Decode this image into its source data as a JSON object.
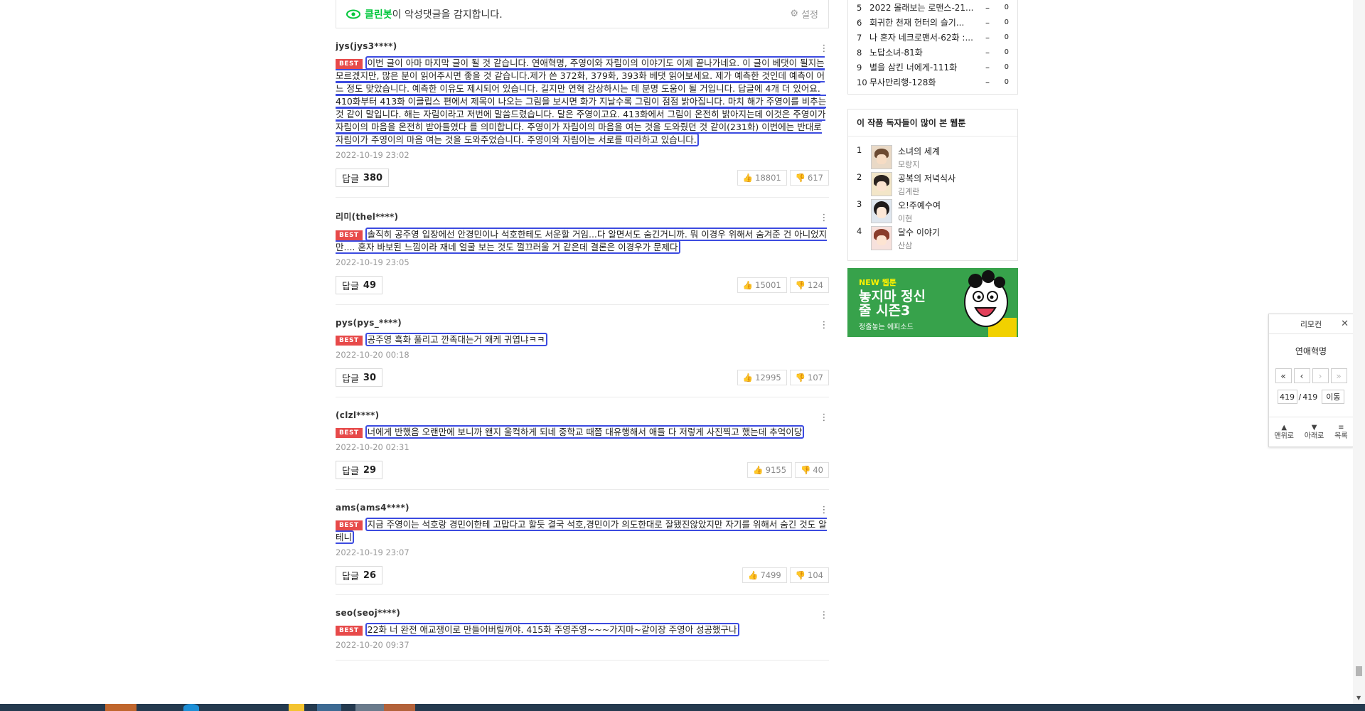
{
  "cleanbot": {
    "brand": "클린봇",
    "text": "이 악성댓글을 감지합니다.",
    "setting_label": "설정"
  },
  "comments": [
    {
      "user": "jys(jys3****)",
      "badge": "BEST",
      "text": "이번 글이 아마 마지막 글이 될 것 같습니다. 연애혁명, 주영이와 자림이의 이야기도 이제 끝나가네요. 이 글이 베댓이 될지는 모르겠지만, 많은 분이 읽어주시면 좋을 것 같습니다.제가 쓴 372화, 379화, 393화 베댓 읽어보세요. 제가 예측한 것인데 예측이 어느 정도 맞았습니다. 예측한 이유도 제시되어 있습니다. 길지만 연혁 감상하시는 데 분명 도움이 될 거입니다. 답글에 4개 더 있어요. 410화부터 413화 이클립스 편에서 제목이 나오는 그림을 보시면 화가 지날수록 그림이 점점 밝아집니다. 마치 해가 주영이를 비추는 것 같이 말입니다. 해는 자림이라고 저번에 말씀드렸습니다. 달은 주영이고요. 413화에서 그림이 온전히 밝아지는데 이것은 주영이가 자림이의 마음을 온전히 받아들였다 를 의미합니다. 주영이가 자림이의 마음을 여는 것을 도와줬던 것 같이(231화) 이번에는 반대로 자림이가 주영이의 마음 여는 것을 도와주었습니다. 주영이와 자림이는 서로를 따라하고 있습니다.",
      "date": "2022-10-19 23:02",
      "reply_label": "답글",
      "replies": "380",
      "up": "18801",
      "down": "617"
    },
    {
      "user": "리미(thel****)",
      "badge": "BEST",
      "text": "솔직히 공주영 입장에선 안경민이나 석호한테도 서운할 거임...다 알면서도 숨긴거니까. 뭐 이경우 위해서 숨겨준 건 아니었지만.... 혼자 바보된 느낌이라 재네 얼굴 보는 것도 껄끄러울 거 같은데 결론은 이경우가 문제다",
      "date": "2022-10-19 23:05",
      "reply_label": "답글",
      "replies": "49",
      "up": "15001",
      "down": "124"
    },
    {
      "user": "pys(pys_****)",
      "badge": "BEST",
      "text": "공주영 흑화 풀리고 깐족대는거 왜케 귀엽냐ㅋㅋ",
      "date": "2022-10-20 00:18",
      "reply_label": "답글",
      "replies": "30",
      "up": "12995",
      "down": "107"
    },
    {
      "user": "(clzl****)",
      "badge": "BEST",
      "text": "너에게 반했음 오랜만에 보니까 왠지 울컥하게 되네 중학교 때쯤 대유행해서 애들 다 저렇게 사진찍고 했는데 추억이당",
      "date": "2022-10-20 02:31",
      "reply_label": "답글",
      "replies": "29",
      "up": "9155",
      "down": "40"
    },
    {
      "user": "ams(ams4****)",
      "badge": "BEST",
      "text": "지금 주영이는 석호랑 경민이한테 고맙다고 할듯 결국 석호,경민이가 의도한대로 잘됐진않았지만 자기를 위해서 숨긴 것도 알테니",
      "date": "2022-10-19 23:07",
      "reply_label": "답글",
      "replies": "26",
      "up": "7499",
      "down": "104"
    },
    {
      "user": "seo(seoj****)",
      "badge": "BEST",
      "text": "22화 너 완전 애교쟁이로 만들어버릴꺼야. 415화 주영주영~~~가지마~같이장 주영아 성공했구나",
      "date": "2022-10-20 09:37",
      "reply_label": "답글",
      "replies": "",
      "up": "",
      "down": ""
    }
  ],
  "ranking": [
    {
      "num": "5",
      "title": "2022 몰래보는 로맨스-21...",
      "change": "–",
      "count": "0"
    },
    {
      "num": "6",
      "title": "회귀한 천재 헌터의 슬기...",
      "change": "–",
      "count": "0"
    },
    {
      "num": "7",
      "title": "나 혼자 네크로맨서-62화 :...",
      "change": "–",
      "count": "0"
    },
    {
      "num": "8",
      "title": "노답소녀-81화",
      "change": "–",
      "count": "0"
    },
    {
      "num": "9",
      "title": "별을 삼킨 너에게-111화",
      "change": "–",
      "count": "0"
    },
    {
      "num": "10",
      "title": "무사만리행-128화",
      "change": "–",
      "count": "0"
    }
  ],
  "popular": {
    "heading": "이 작품 독자들이 많이 본 웹툰",
    "items": [
      {
        "num": "1",
        "title": "소녀의 세계",
        "author": "모랑지"
      },
      {
        "num": "2",
        "title": "공복의 저녁식사",
        "author": "김계란"
      },
      {
        "num": "3",
        "title": "오!주예수여",
        "author": "이현"
      },
      {
        "num": "4",
        "title": "달수 이야기",
        "author": "산삼"
      }
    ]
  },
  "banner": {
    "tag": "NEW 웹툰",
    "title": "놓지마 정신줄 시즌3",
    "subtitle": "정줄놓는 에피소드"
  },
  "remote": {
    "header": "리모컨",
    "title": "연애혁명",
    "current_page": "419",
    "total_pages": "419",
    "go_label": "이동",
    "top_label": "맨위로",
    "bottom_label": "아래로",
    "list_label": "목록"
  },
  "colors": {
    "accent_green": "#00c73c",
    "best_red": "#e74a4a",
    "highlight_blue": "#3c4be0",
    "banner_green": "#37a24b"
  }
}
